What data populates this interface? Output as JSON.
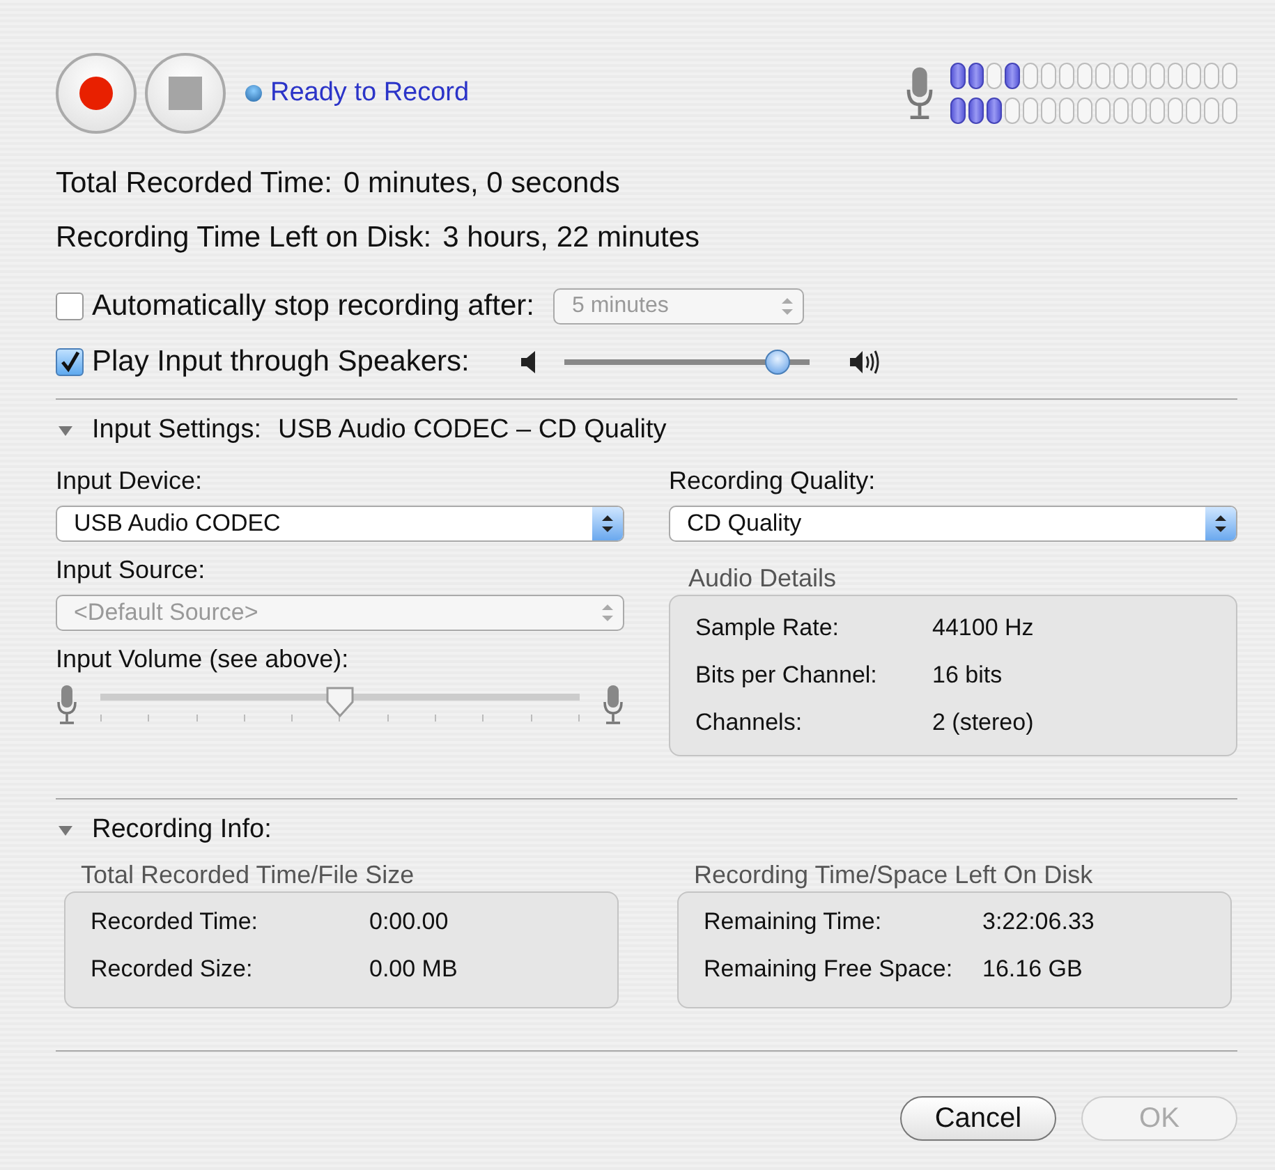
{
  "status": {
    "text": "Ready to Record"
  },
  "meters": [
    {
      "segments": [
        true,
        true,
        false,
        true,
        false,
        false,
        false,
        false,
        false,
        false,
        false,
        false,
        false,
        false,
        false,
        false
      ]
    },
    {
      "segments": [
        true,
        true,
        true,
        false,
        false,
        false,
        false,
        false,
        false,
        false,
        false,
        false,
        false,
        false,
        false,
        false
      ]
    }
  ],
  "summary": [
    {
      "label": "Total Recorded Time:",
      "value": "0 minutes, 0 seconds"
    },
    {
      "label": "Recording Time Left on Disk:",
      "value": "3 hours, 22 minutes"
    }
  ],
  "auto_stop": {
    "label": "Automatically stop recording after:",
    "checked": false,
    "value": "5 minutes",
    "disabled": true
  },
  "play_through": {
    "label": "Play Input through Speakers:",
    "checked": true,
    "level": 0.87
  },
  "input_settings": {
    "title": "Input Settings:",
    "summary": "USB Audio CODEC  – CD Quality",
    "expanded": true,
    "device": {
      "label": "Input Device:",
      "value": "USB Audio CODEC",
      "disabled": false
    },
    "source": {
      "label": "Input Source:",
      "value": "<Default Source>",
      "disabled": true
    },
    "volume": {
      "label": "Input Volume (see above):",
      "level": 0.5
    },
    "quality": {
      "label": "Recording Quality:",
      "value": "CD Quality",
      "disabled": false
    },
    "details": {
      "title": "Audio Details",
      "rows": [
        {
          "label": "Sample Rate:",
          "value": "44100 Hz"
        },
        {
          "label": "Bits per Channel:",
          "value": "16 bits"
        },
        {
          "label": "Channels:",
          "value": "2 (stereo)"
        }
      ]
    }
  },
  "recording_info": {
    "title": "Recording Info:",
    "expanded": true,
    "groups": [
      {
        "title": "Total Recorded Time/File Size",
        "rows": [
          {
            "label": "Recorded Time:",
            "value": "0:00.00"
          },
          {
            "label": "Recorded Size:",
            "value": "0.00 MB"
          }
        ]
      },
      {
        "title": "Recording Time/Space Left On Disk",
        "rows": [
          {
            "label": "Remaining Time:",
            "value": "3:22:06.33"
          },
          {
            "label": "Remaining Free Space:",
            "value": "16.16 GB"
          }
        ]
      }
    ]
  },
  "buttons": [
    {
      "label": "Cancel",
      "disabled": false
    },
    {
      "label": "OK",
      "disabled": true
    }
  ]
}
